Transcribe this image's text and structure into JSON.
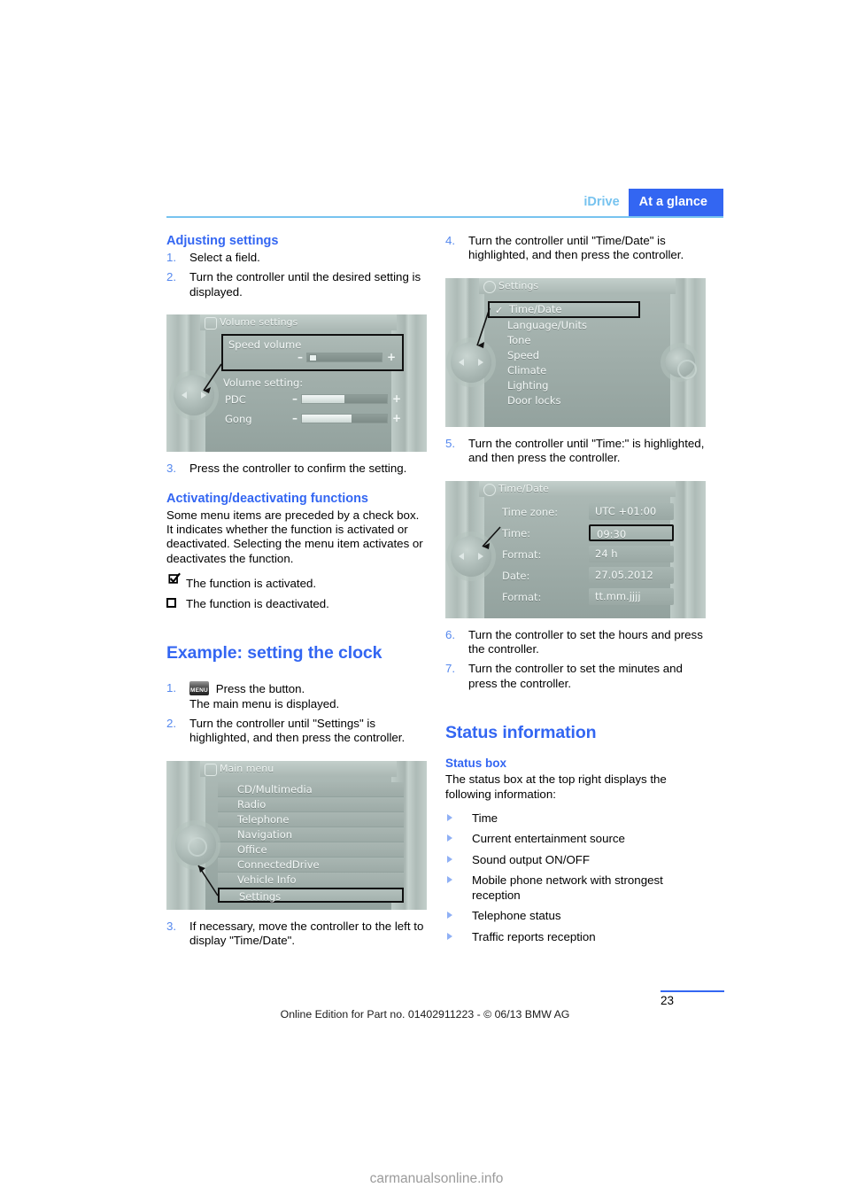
{
  "header": {
    "chapter": "iDrive",
    "section": "At a glance"
  },
  "left_column": {
    "adjusting_settings": {
      "heading": "Adjusting settings",
      "steps": [
        {
          "num": "1.",
          "text": "Select a field."
        },
        {
          "num": "2.",
          "text": "Turn the controller until the desired setting is displayed."
        }
      ],
      "step3": {
        "num": "3.",
        "text": "Press the controller to confirm the setting."
      }
    },
    "volume_figure": {
      "title": "Volume settings",
      "title_icon": "speaker-icon",
      "panel_label": "Speed volume",
      "group_label": "Volume setting:",
      "rows": [
        {
          "label": "PDC",
          "minus": "–",
          "plus": "+",
          "fill_percent": 50
        },
        {
          "label": "Gong",
          "minus": "–",
          "plus": "+",
          "fill_percent": 58
        }
      ],
      "speed_slider": {
        "minus": "–",
        "plus": "+",
        "cursor_percent": 8
      }
    },
    "activating": {
      "heading": "Activating/deactivating functions",
      "paragraph": "Some menu items are preceded by a check box. It indicates whether the function is activated or deactivated. Selecting the menu item activates or deactivates the function.",
      "legend": [
        {
          "icon": "checkbox-checked-icon",
          "text": "The function is activated."
        },
        {
          "icon": "checkbox-unchecked-icon",
          "text": "The function is deactivated."
        }
      ]
    },
    "example_clock": {
      "heading": "Example: setting the clock",
      "step1": {
        "num": "1.",
        "button_glyph": "MENU",
        "text": "Press the button.",
        "subtext": "The main menu is displayed."
      },
      "step2": {
        "num": "2.",
        "text": "Turn the controller until \"Settings\" is highlighted, and then press the controller."
      },
      "step3": {
        "num": "3.",
        "text": "If necessary, move the controller to the left to display \"Time/Date\"."
      }
    },
    "main_menu_figure": {
      "title": "Main menu",
      "title_icon": "display-icon",
      "items": [
        {
          "label": "CD/Multimedia",
          "selected": false
        },
        {
          "label": "Radio",
          "selected": false
        },
        {
          "label": "Telephone",
          "selected": false
        },
        {
          "label": "Navigation",
          "selected": false
        },
        {
          "label": "Office",
          "selected": false
        },
        {
          "label": "ConnectedDrive",
          "selected": false
        },
        {
          "label": "Vehicle Info",
          "selected": false
        },
        {
          "label": "Settings",
          "selected": true
        }
      ]
    }
  },
  "right_column": {
    "step4": {
      "num": "4.",
      "text": "Turn the controller until \"Time/Date\" is highlighted, and then press the controller."
    },
    "settings_figure": {
      "title": "Settings",
      "title_icon": "gear-icon",
      "items": [
        {
          "label": "Time/Date",
          "selected": true,
          "checked": true
        },
        {
          "label": "Language/Units",
          "selected": false,
          "checked": false
        },
        {
          "label": "Tone",
          "selected": false,
          "checked": false
        },
        {
          "label": "Speed",
          "selected": false,
          "checked": false
        },
        {
          "label": "Climate",
          "selected": false,
          "checked": false
        },
        {
          "label": "Lighting",
          "selected": false,
          "checked": false
        },
        {
          "label": "Door locks",
          "selected": false,
          "checked": false
        }
      ]
    },
    "step5": {
      "num": "5.",
      "text": "Turn the controller until \"Time:\" is highlighted, and then press the controller."
    },
    "timedate_figure": {
      "title": "Time/Date",
      "title_icon": "clock-icon",
      "rows": [
        {
          "key": "Time zone:",
          "value": "UTC +01:00",
          "selected": false
        },
        {
          "key": "Time:",
          "value": "09:30",
          "selected": true
        },
        {
          "key": "Format:",
          "value": "24 h",
          "selected": false
        },
        {
          "key": "Date:",
          "value": "27.05.2012",
          "selected": false
        },
        {
          "key": "Format:",
          "value": "tt.mm.jjjj",
          "selected": false
        }
      ]
    },
    "step6": {
      "num": "6.",
      "text": "Turn the controller to set the hours and press the controller."
    },
    "step7": {
      "num": "7.",
      "text": "Turn the controller to set the minutes and press the controller."
    },
    "status_information": {
      "heading": "Status information",
      "subheading": "Status box",
      "paragraph": "The status box at the top right displays the following information:",
      "bullets": [
        "Time",
        "Current entertainment source",
        "Sound output ON/OFF",
        "Mobile phone network with strongest reception",
        "Telephone status",
        "Traffic reports reception"
      ]
    }
  },
  "footer": {
    "note": "Online Edition for Part no. 01402911223 - © 06/13 BMW AG",
    "page_number": "23",
    "watermark": "carmanualsonline.info"
  },
  "colors": {
    "accent_blue": "#3366f2",
    "light_blue": "#77c3ef",
    "step_number_blue": "#5588ee",
    "screen_grey": "#a9b6b2"
  }
}
